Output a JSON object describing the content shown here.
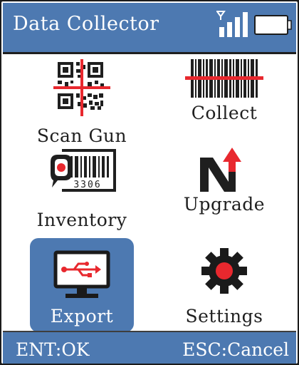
{
  "header": {
    "title": "Data Collector",
    "signal_icon": "signal-strength-icon",
    "battery_icon": "battery-icon"
  },
  "menu": {
    "items": [
      {
        "label": "Scan Gun",
        "icon": "qr-code-scan-icon",
        "selected": false
      },
      {
        "label": "Collect",
        "icon": "barcode-icon",
        "selected": false
      },
      {
        "label": "Inventory",
        "icon": "inventory-barcode-icon",
        "selected": false,
        "barcode_digits": "3306"
      },
      {
        "label": "Upgrade",
        "icon": "upgrade-arrow-icon",
        "selected": false
      },
      {
        "label": "Export",
        "icon": "usb-monitor-icon",
        "selected": true
      },
      {
        "label": "Settings",
        "icon": "gear-icon",
        "selected": false
      }
    ]
  },
  "footer": {
    "left_key": "ENT:OK",
    "right_key": "ESC:Cancel"
  },
  "colors": {
    "bar": "#4d79b1",
    "accent_red": "#e8282e",
    "dark": "#1f1f1f"
  }
}
